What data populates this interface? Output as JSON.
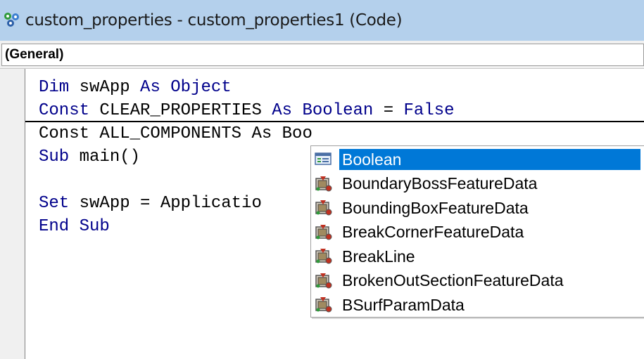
{
  "window": {
    "title": "custom_properties - custom_properties1 (Code)"
  },
  "procedure_combo": {
    "value": "(General)"
  },
  "code_lines": [
    [
      {
        "t": "Dim",
        "k": true
      },
      {
        "t": " swApp ",
        "k": false
      },
      {
        "t": "As",
        "k": true
      },
      {
        "t": " ",
        "k": false
      },
      {
        "t": "Object",
        "k": true
      }
    ],
    [
      {
        "t": "Const",
        "k": true
      },
      {
        "t": " CLEAR_PROPERTIES ",
        "k": false
      },
      {
        "t": "As",
        "k": true
      },
      {
        "t": " ",
        "k": false
      },
      {
        "t": "Boolean",
        "k": true
      },
      {
        "t": " = ",
        "k": false
      },
      {
        "t": "False",
        "k": true
      }
    ],
    [
      {
        "t": "Const ALL_COMPONENTS As Boo",
        "k": false
      }
    ],
    [
      {
        "t": "Sub",
        "k": true
      },
      {
        "t": " main()",
        "k": false
      }
    ],
    [
      {
        "t": "",
        "k": false
      }
    ],
    [
      {
        "t": "Set",
        "k": true
      },
      {
        "t": " swApp = Applicatio",
        "k": false
      }
    ],
    [
      {
        "t": "End",
        "k": true
      },
      {
        "t": " ",
        "k": false
      },
      {
        "t": "Sub",
        "k": true
      }
    ]
  ],
  "autocomplete": {
    "items": [
      {
        "label": "Boolean",
        "icon": "enum-icon",
        "selected": true
      },
      {
        "label": "BoundaryBossFeatureData",
        "icon": "class-icon",
        "selected": false
      },
      {
        "label": "BoundingBoxFeatureData",
        "icon": "class-icon",
        "selected": false
      },
      {
        "label": "BreakCornerFeatureData",
        "icon": "class-icon",
        "selected": false
      },
      {
        "label": "BreakLine",
        "icon": "class-icon",
        "selected": false
      },
      {
        "label": "BrokenOutSectionFeatureData",
        "icon": "class-icon",
        "selected": false
      },
      {
        "label": "BSurfParamData",
        "icon": "class-icon",
        "selected": false
      }
    ]
  },
  "colors": {
    "titlebar": "#b4d0ec",
    "keyword": "#00008b",
    "selection": "#0078d7"
  }
}
